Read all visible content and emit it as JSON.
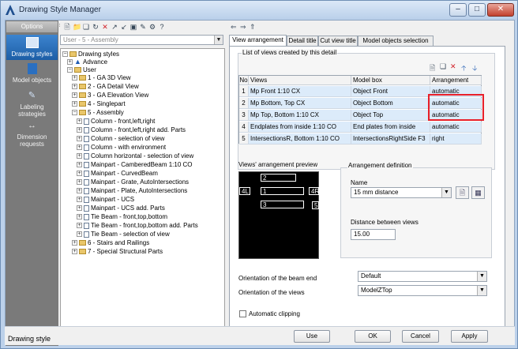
{
  "window": {
    "title": "Drawing Style Manager",
    "min": "–",
    "max": "□",
    "close": "✕"
  },
  "sidebar": {
    "header": "Options",
    "items": [
      {
        "label": "Drawing styles",
        "icon": "drawing-styles-icon"
      },
      {
        "label": "Model objects",
        "icon": "model-objects-icon"
      },
      {
        "label": "Labeling strategies",
        "icon": "labeling-icon"
      },
      {
        "label": "Dimension requests",
        "icon": "dimension-icon"
      }
    ]
  },
  "tree_toolbar": {
    "combo_value": "User - 5 - Assembly"
  },
  "tree": [
    {
      "label": "Drawing styles"
    },
    {
      "label": "Advance"
    },
    {
      "label": "User"
    },
    {
      "label": "1 - GA 3D View"
    },
    {
      "label": "2 - GA Detail View"
    },
    {
      "label": "3 - GA Elevation View"
    },
    {
      "label": "4 - Singlepart"
    },
    {
      "label": "5 - Assembly"
    },
    {
      "label": "Column - front,left,right"
    },
    {
      "label": "Column - front,left,right add. Parts"
    },
    {
      "label": "Column - selection of view"
    },
    {
      "label": "Column - with environment"
    },
    {
      "label": "Column horizontal - selection of view"
    },
    {
      "label": "Mainpart - CamberedBeam 1:10 CO"
    },
    {
      "label": "Mainpart - CurvedBeam"
    },
    {
      "label": "Mainpart - Grate, AutoIntersections"
    },
    {
      "label": "Mainpart - Plate, AutoIntersections"
    },
    {
      "label": "Mainpart - UCS"
    },
    {
      "label": "Mainpart - UCS add. Parts"
    },
    {
      "label": "Tie Beam - front,top,bottom"
    },
    {
      "label": "Tie Beam - front,top,bottom add. Parts"
    },
    {
      "label": "Tie Beam - selection of view"
    },
    {
      "label": "6 - Stairs and Railings"
    },
    {
      "label": "7 - Special Structural Parts"
    }
  ],
  "tabs": [
    "View arrangement",
    "Detail title",
    "Cut view title",
    "Model objects selection"
  ],
  "views_group": {
    "label": "List of views created by this detail",
    "columns": [
      "No",
      "Views",
      "Model box",
      "Arrangement"
    ],
    "rows": [
      {
        "no": "1",
        "view": "Mp Front 1:10 CX",
        "box": "Object Front",
        "arr": "automatic"
      },
      {
        "no": "2",
        "view": "Mp Bottom, Top CX",
        "box": "Object Bottom",
        "arr": "automatic"
      },
      {
        "no": "3",
        "view": "Mp Top, Bottom 1:10 CX",
        "box": "Object Top",
        "arr": "automatic"
      },
      {
        "no": "4",
        "view": "Endplates from inside 1:10 CO",
        "box": "End plates from inside",
        "arr": "automatic"
      },
      {
        "no": "5",
        "view": "IntersectionsR, Bottom 1:10 CO",
        "box": "IntersectionsRightSide F3",
        "arr": "right"
      }
    ]
  },
  "preview": {
    "label": "Views' arrangement preview",
    "boxes": [
      "2",
      "1",
      "3",
      "4L",
      "4R",
      "5"
    ]
  },
  "arrangement": {
    "label": "Arrangement definition",
    "name_label": "Name",
    "name_value": "15 mm distance",
    "distance_label": "Distance between views",
    "distance_value": "15.00"
  },
  "orientation": {
    "beam_end_label": "Orientation of the beam end",
    "beam_end_value": "Default",
    "views_label": "Orientation of the views",
    "views_value": "ModelZTop",
    "clipping_label": "Automatic clipping"
  },
  "status": {
    "text": "Drawing style"
  },
  "buttons": {
    "use": "Use",
    "ok": "OK",
    "cancel": "Cancel",
    "apply": "Apply"
  }
}
